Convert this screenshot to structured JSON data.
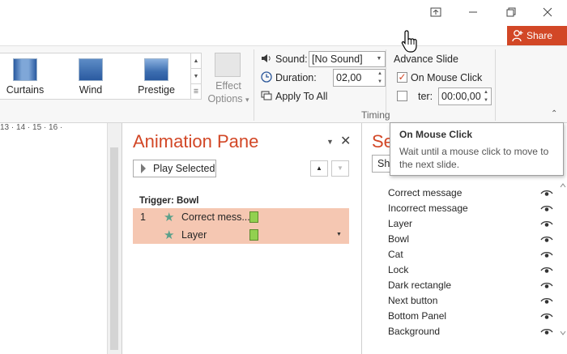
{
  "ribbon": {
    "transitions": [
      {
        "label": "Curtains",
        "icon": "curtains-transition-icon"
      },
      {
        "label": "Wind",
        "icon": "wind-transition-icon"
      },
      {
        "label": "Prestige",
        "icon": "prestige-transition-icon"
      }
    ],
    "effect_options": {
      "line1": "Effect",
      "line2": "Options",
      "arrow": "▾"
    },
    "timing": {
      "sound_label": "Sound:",
      "sound_value": "[No Sound]",
      "duration_label": "Duration:",
      "duration_value": "02,00",
      "apply_all_label": "Apply To All",
      "group_label": "Timing"
    },
    "advance": {
      "heading": "Advance Slide",
      "on_click_label": "On Mouse Click",
      "on_click_checked": true,
      "after_label": "ter:",
      "after_value": "00:00,00"
    }
  },
  "share": {
    "label": "Share",
    "color": "#d24726"
  },
  "ruler": {
    "ticks": "13 · 14 · 15 · 16 ·"
  },
  "animation_pane": {
    "title": "Animation Pane",
    "play_label": "Play Selected",
    "trigger": "Trigger: Bowl",
    "rows": [
      {
        "num": "1",
        "name": "Correct mess..."
      },
      {
        "num": "",
        "name": "Layer"
      }
    ]
  },
  "selection_pane": {
    "title_fragment": "Se",
    "button_fragment": "Sh",
    "items": [
      "Correct message",
      "Incorrect message",
      "Layer",
      "Bowl",
      "Cat",
      "Lock",
      "Dark rectangle",
      "Next button",
      "Bottom Panel",
      "Background"
    ]
  },
  "tooltip": {
    "title": "On Mouse Click",
    "description": "Wait until a mouse click to move to the next slide."
  },
  "colors": {
    "accent": "#d24726",
    "row_highlight": "#f5c7b2",
    "bar": "#92d050"
  }
}
